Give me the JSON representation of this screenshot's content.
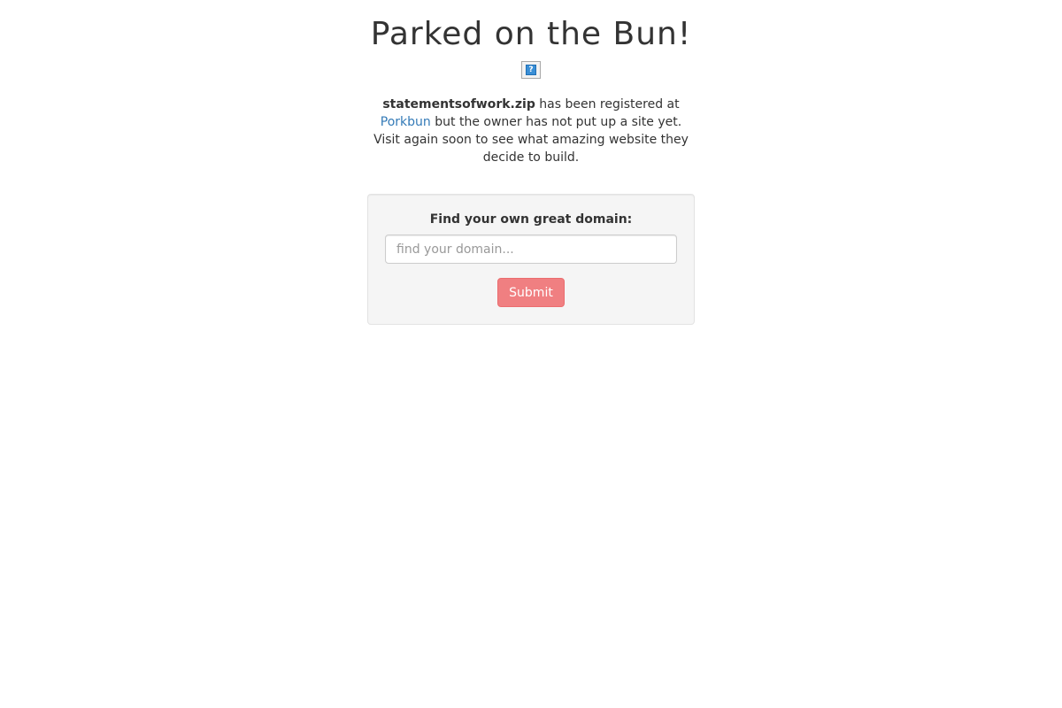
{
  "header": {
    "title": "Parked on the Bun!"
  },
  "image": {
    "icon": "broken-image-icon",
    "glyph": "?"
  },
  "message": {
    "domain": "statementsofwork.zip",
    "text_part1": " has been registered at ",
    "registrar_link": "Porkbun",
    "text_part2": " but the owner has not put up a site yet. Visit again soon to see what amazing website they decide to build."
  },
  "search": {
    "label": "Find your own great domain:",
    "value": "",
    "placeholder": "find your domain...",
    "submit_label": "Submit"
  },
  "colors": {
    "link": "#337ab7",
    "submit_button": "#f07f81",
    "panel_background": "#f5f5f5"
  }
}
